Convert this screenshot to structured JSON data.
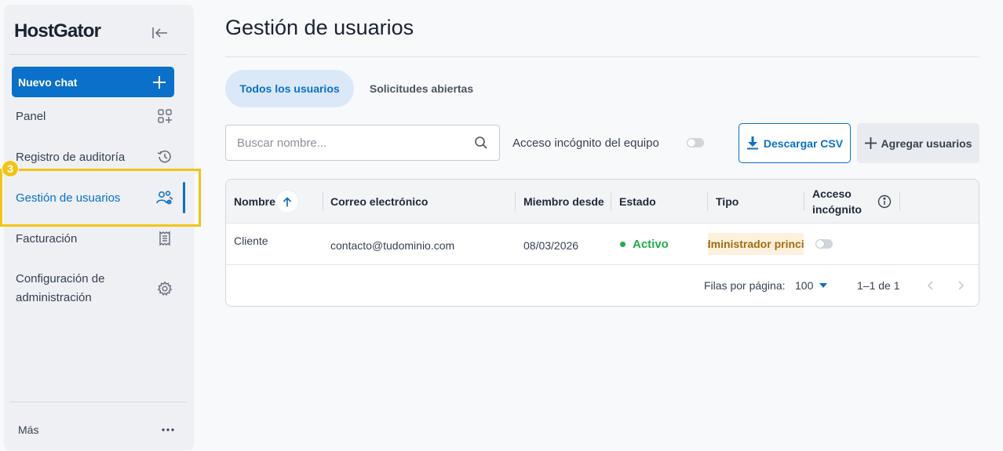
{
  "sidebar": {
    "logo": "HostGator",
    "new_chat": "Nuevo chat",
    "items": [
      {
        "label": "Panel",
        "icon": "grid-plus-icon"
      },
      {
        "label": "Registro de auditoría",
        "icon": "history-icon"
      },
      {
        "label": "Gestión de usuarios",
        "icon": "users-gear-icon",
        "active": true
      },
      {
        "label": "Facturación",
        "icon": "receipt-icon"
      },
      {
        "label_line1": "Configuración de",
        "label_line2": "administración",
        "icon": "gear-icon"
      }
    ],
    "more": "Más",
    "step_badge": "3"
  },
  "main": {
    "title": "Gestión de usuarios",
    "tabs": [
      {
        "label": "Todos los usuarios",
        "active": true
      },
      {
        "label": "Solicitudes abiertas",
        "active": false
      }
    ],
    "search": {
      "placeholder": "Buscar nombre..."
    },
    "team_incognito_label": "Acceso incógnito del equipo",
    "download_csv": "Descargar CSV",
    "add_users": "Agregar usuarios"
  },
  "table": {
    "headers": {
      "name": "Nombre",
      "email": "Correo electrónico",
      "member_since": "Miembro desde",
      "status": "Estado",
      "type": "Tipo",
      "incognito_line1": "Acceso",
      "incognito_line2": "incógnito"
    },
    "rows": [
      {
        "name": "Cliente",
        "email": "contacto@tudominio.com",
        "member_since": "08/03/2026",
        "status": "Activo",
        "type": "Administrador principal"
      }
    ],
    "footer": {
      "rows_per_page_label": "Filas por página:",
      "rows_per_page": "100",
      "range": "1–1 de 1"
    }
  },
  "colors": {
    "accent": "#0a70c9",
    "active_status": "#1fae4a",
    "type_badge_bg": "#fdf1dd",
    "highlight": "#f2c416"
  }
}
